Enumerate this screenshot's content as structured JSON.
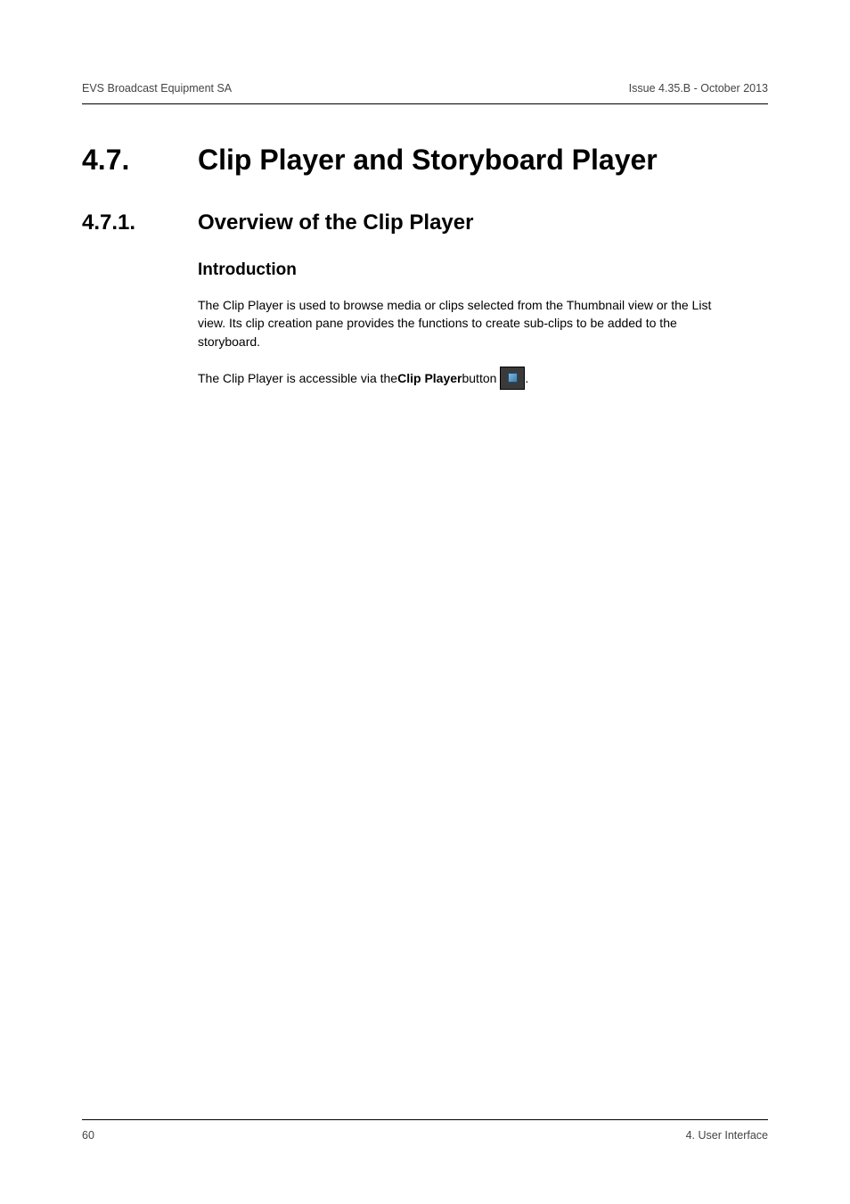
{
  "header": {
    "left": "EVS Broadcast Equipment SA",
    "right": "Issue 4.35.B - October 2013"
  },
  "h1": {
    "num": "4.7.",
    "text": "Clip Player and Storyboard Player"
  },
  "h2": {
    "num": "4.7.1.",
    "text": "Overview of the Clip Player"
  },
  "h3": "Introduction",
  "para1": "The Clip Player is used to browse media or clips selected from the Thumbnail view or the List view. Its clip creation pane provides the functions to create sub-clips to be added to the storyboard.",
  "para2": {
    "pre": "The Clip Player is accessible via the ",
    "boldLabel": "Clip Player",
    "mid": " button ",
    "post": "."
  },
  "footer": {
    "left": "60",
    "right": "4. User Interface"
  }
}
